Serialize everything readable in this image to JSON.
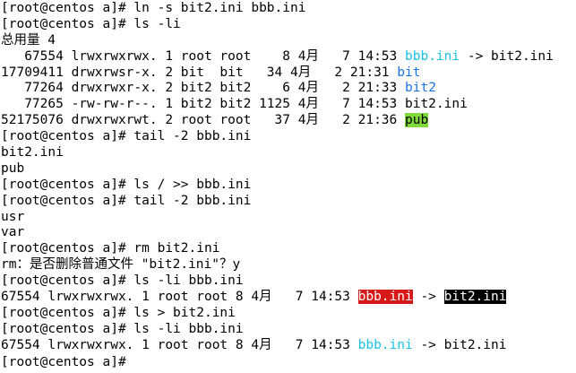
{
  "terminal": {
    "lines": [
      [
        {
          "t": "[root@centos a]# ln -s bit2.ini bbb.ini"
        }
      ],
      [
        {
          "t": "[root@centos a]# ls -li"
        }
      ],
      [
        {
          "t": "总用量 4"
        }
      ],
      [
        {
          "t": "   67554 lrwxrwxrwx. 1 root root    8 4月   7 14:53 "
        },
        {
          "t": "bbb.ini",
          "c": "c-cyan"
        },
        {
          "t": " -> bit2.ini"
        }
      ],
      [
        {
          "t": "17709411 drwxrwsr-x. 2 bit  bit   34 4月   2 21:31 "
        },
        {
          "t": "bit",
          "c": "c-blue"
        }
      ],
      [
        {
          "t": "   77264 drwxrwxr-x. 2 bit2 bit2    6 4月   2 21:33 "
        },
        {
          "t": "bit2",
          "c": "c-blue"
        }
      ],
      [
        {
          "t": "   77265 -rw-rw-r--. 1 bit2 bit2 1125 4月   7 14:53 bit2.ini"
        }
      ],
      [
        {
          "t": "52175076 drwxrwxrwt. 2 root root   37 4月   2 21:36 "
        },
        {
          "t": "pub",
          "c": "hl-green"
        }
      ],
      [
        {
          "t": "[root@centos a]# tail -2 bbb.ini"
        }
      ],
      [
        {
          "t": "bit2.ini"
        }
      ],
      [
        {
          "t": "pub"
        }
      ],
      [
        {
          "t": "[root@centos a]# ls / >> bbb.ini"
        }
      ],
      [
        {
          "t": "[root@centos a]# tail -2 bbb.ini"
        }
      ],
      [
        {
          "t": "usr"
        }
      ],
      [
        {
          "t": "var"
        }
      ],
      [
        {
          "t": "[root@centos a]# rm bit2.ini"
        }
      ],
      [
        {
          "t": "rm：是否删除普通文件 \"bit2.ini\"？y"
        }
      ],
      [
        {
          "t": "[root@centos a]# ls -li bbb.ini"
        }
      ],
      [
        {
          "t": "67554 lrwxrwxrwx. 1 root root 8 4月   7 14:53 "
        },
        {
          "t": "bbb.ini",
          "c": "hl-red"
        },
        {
          "t": " -> "
        },
        {
          "t": "bit2.ini",
          "c": "hl-black"
        }
      ],
      [
        {
          "t": "[root@centos a]# ls > bit2.ini"
        }
      ],
      [
        {
          "t": "[root@centos a]# ls -li bbb.ini"
        }
      ],
      [
        {
          "t": "67554 lrwxrwxrwx. 1 root root 8 4月   7 14:53 "
        },
        {
          "t": "bbb.ini",
          "c": "c-cyan"
        },
        {
          "t": " -> bit2.ini"
        }
      ],
      [
        {
          "t": "[root@centos a]# "
        }
      ]
    ]
  },
  "colors": {
    "background": "#ffffff",
    "text": "#000000",
    "symlink": "#19c2e6",
    "directory": "#1a73e8",
    "sticky_dir_bg": "#7fd93a",
    "broken_link_bg": "#d81919",
    "missing_target_bg": "#000000"
  }
}
